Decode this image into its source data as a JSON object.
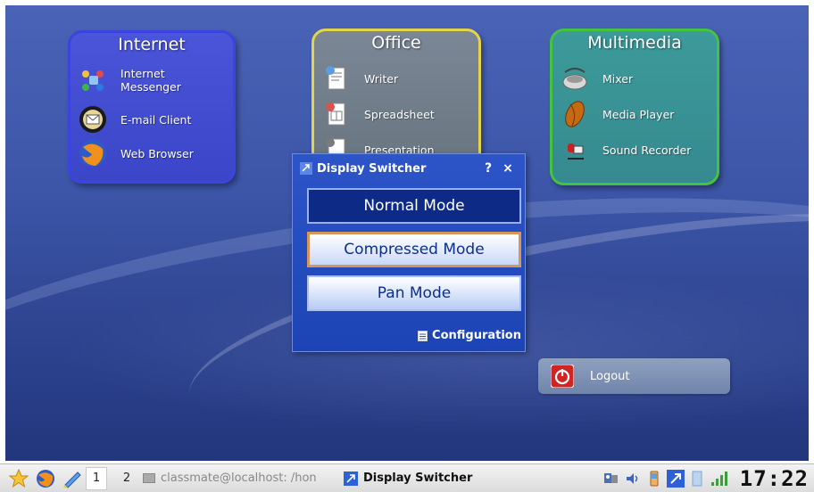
{
  "desktop": {
    "groups": {
      "internet": {
        "title": "Internet",
        "apps": [
          {
            "label": "Internet Messenger",
            "icon": "messenger-icon"
          },
          {
            "label": "E-mail Client",
            "icon": "email-client-icon"
          },
          {
            "label": "Web Browser",
            "icon": "web-browser-icon"
          }
        ]
      },
      "office": {
        "title": "Office",
        "apps": [
          {
            "label": "Writer",
            "icon": "writer-icon"
          },
          {
            "label": "Spreadsheet",
            "icon": "spreadsheet-icon"
          },
          {
            "label": "Presentation",
            "icon": "presentation-icon"
          }
        ]
      },
      "multimedia": {
        "title": "Multimedia",
        "apps": [
          {
            "label": "Mixer",
            "icon": "mixer-icon"
          },
          {
            "label": "Media Player",
            "icon": "media-player-icon"
          },
          {
            "label": "Sound Recorder",
            "icon": "sound-recorder-icon"
          }
        ]
      }
    },
    "logout": {
      "label": "Logout",
      "icon": "power-icon"
    }
  },
  "display_switcher": {
    "title": "Display Switcher",
    "help": "?",
    "close": "×",
    "modes": [
      "Normal Mode",
      "Compressed Mode",
      "Pan Mode"
    ],
    "selected_mode": "Compressed Mode",
    "configuration": "Configuration"
  },
  "taskbar": {
    "workspaces": [
      "1",
      "2"
    ],
    "tasks": [
      "classmate@localhost: /hon",
      "Display Switcher"
    ],
    "clock": "17:22"
  }
}
